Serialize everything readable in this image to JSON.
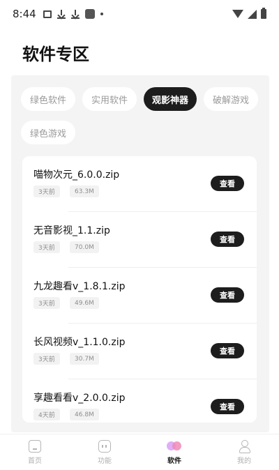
{
  "status_bar": {
    "time": "8:44"
  },
  "page": {
    "title": "软件专区"
  },
  "categories": [
    {
      "label": "绿色软件",
      "active": false
    },
    {
      "label": "实用软件",
      "active": false
    },
    {
      "label": "观影神器",
      "active": true
    },
    {
      "label": "破解游戏",
      "active": false
    },
    {
      "label": "绿色游戏",
      "active": false
    }
  ],
  "items": [
    {
      "name": "喵物次元_6.0.0.zip",
      "age": "3天前",
      "size": "63.3M",
      "action": "查看"
    },
    {
      "name": "无音影视_1.1.zip",
      "age": "3天前",
      "size": "70.0M",
      "action": "查看"
    },
    {
      "name": "九龙趣看v_1.8.1.zip",
      "age": "3天前",
      "size": "49.6M",
      "action": "查看"
    },
    {
      "name": "长风视频v_1.1.0.zip",
      "age": "3天前",
      "size": "30.7M",
      "action": "查看"
    },
    {
      "name": "享趣看看v_2.0.0.zip",
      "age": "4天前",
      "size": "46.8M",
      "action": "查看"
    }
  ],
  "bottom_nav": [
    {
      "label": "首页",
      "icon": "home-icon",
      "active": false
    },
    {
      "label": "功能",
      "icon": "function-icon",
      "active": false
    },
    {
      "label": "软件",
      "icon": "software-icon",
      "active": true
    },
    {
      "label": "我的",
      "icon": "profile-icon",
      "active": false
    }
  ],
  "colors": {
    "accent_dark": "#1d1d1d",
    "panel_bg": "#f4f4f4",
    "muted_text": "#9a9a9a"
  }
}
